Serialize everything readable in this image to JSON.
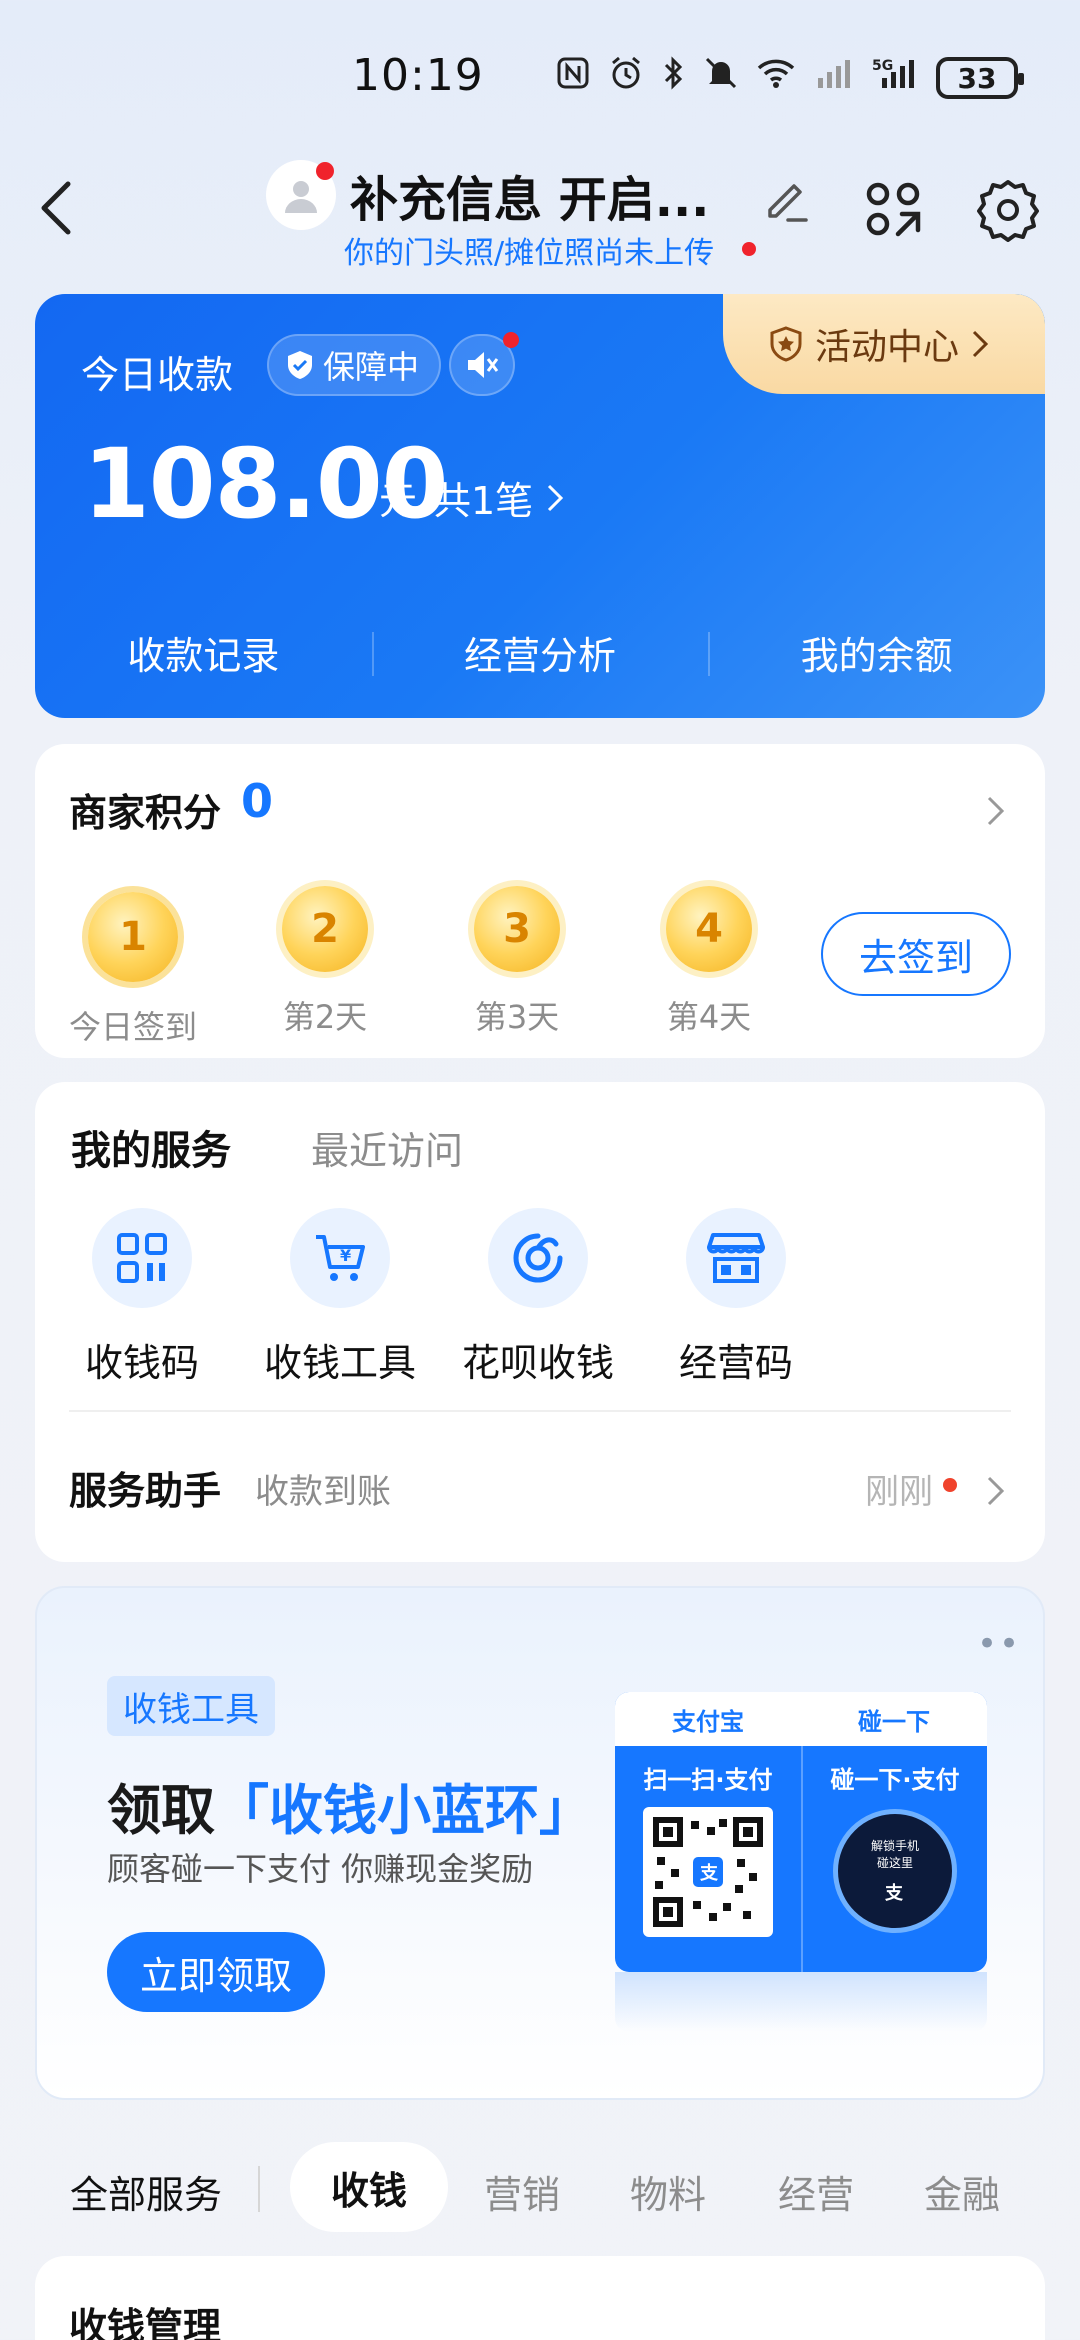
{
  "status_bar": {
    "time": "10:19",
    "battery": "33",
    "icons": [
      "nfc-icon",
      "alarm-icon",
      "bluetooth-icon",
      "mute-icon",
      "wifi-icon",
      "signal-icon",
      "signal-5g-icon"
    ]
  },
  "header": {
    "title": "补充信息 开启...",
    "subtitle": "你的门头照/摊位照尚未上传"
  },
  "revenue_card": {
    "label": "今日收款",
    "guarantee": "保障中",
    "activity": "活动中心",
    "amount": "108.00",
    "unit": "元",
    "count": "共1笔",
    "links": [
      "收款记录",
      "经营分析",
      "我的余额"
    ]
  },
  "points_card": {
    "title": "商家积分",
    "points": "0",
    "days": [
      {
        "num": "1",
        "label": "今日签到"
      },
      {
        "num": "2",
        "label": "第2天"
      },
      {
        "num": "3",
        "label": "第3天"
      },
      {
        "num": "4",
        "label": "第4天"
      }
    ],
    "signin_button": "去签到"
  },
  "services_card": {
    "tabs": [
      "我的服务",
      "最近访问"
    ],
    "items": [
      {
        "label": "收钱码",
        "icon": "qr-code-icon"
      },
      {
        "label": "收钱工具",
        "icon": "cart-icon"
      },
      {
        "label": "花呗收钱",
        "icon": "huabei-icon"
      },
      {
        "label": "经营码",
        "icon": "store-icon"
      }
    ],
    "assistant": {
      "title": "服务助手",
      "subtitle": "收款到账",
      "time": "刚刚"
    }
  },
  "banner": {
    "tag": "收钱工具",
    "title_prefix": "领取",
    "title_highlight": "「收钱小蓝环」",
    "subtitle": "顾客碰一下支付 你赚现金奖励",
    "button": "立即领取",
    "stand_left_brand": "支付宝",
    "stand_right_brand": "碰一下",
    "stand_left_caption": "扫一扫·支付",
    "stand_right_caption": "碰一下·支付",
    "nfc_text_1": "解锁手机",
    "nfc_text_2": "碰这里"
  },
  "categories": {
    "all": "全部服务",
    "tabs": [
      "收钱",
      "营销",
      "物料",
      "经营",
      "金融"
    ],
    "active": "收钱"
  },
  "bottom_card": {
    "title": "收钱管理"
  },
  "colors": {
    "accent": "#1677ff",
    "alert_dot": "#f0232c",
    "gold": "#f4b21f"
  }
}
